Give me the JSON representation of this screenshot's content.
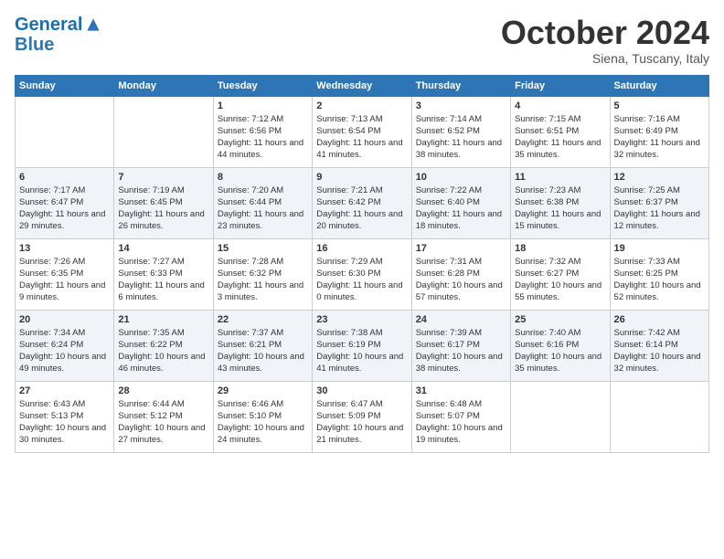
{
  "logo": {
    "line1": "General",
    "line2": "Blue"
  },
  "title": "October 2024",
  "subtitle": "Siena, Tuscany, Italy",
  "days_of_week": [
    "Sunday",
    "Monday",
    "Tuesday",
    "Wednesday",
    "Thursday",
    "Friday",
    "Saturday"
  ],
  "weeks": [
    [
      {
        "day": "",
        "sunrise": "",
        "sunset": "",
        "daylight": ""
      },
      {
        "day": "",
        "sunrise": "",
        "sunset": "",
        "daylight": ""
      },
      {
        "day": "1",
        "sunrise": "Sunrise: 7:12 AM",
        "sunset": "Sunset: 6:56 PM",
        "daylight": "Daylight: 11 hours and 44 minutes."
      },
      {
        "day": "2",
        "sunrise": "Sunrise: 7:13 AM",
        "sunset": "Sunset: 6:54 PM",
        "daylight": "Daylight: 11 hours and 41 minutes."
      },
      {
        "day": "3",
        "sunrise": "Sunrise: 7:14 AM",
        "sunset": "Sunset: 6:52 PM",
        "daylight": "Daylight: 11 hours and 38 minutes."
      },
      {
        "day": "4",
        "sunrise": "Sunrise: 7:15 AM",
        "sunset": "Sunset: 6:51 PM",
        "daylight": "Daylight: 11 hours and 35 minutes."
      },
      {
        "day": "5",
        "sunrise": "Sunrise: 7:16 AM",
        "sunset": "Sunset: 6:49 PM",
        "daylight": "Daylight: 11 hours and 32 minutes."
      }
    ],
    [
      {
        "day": "6",
        "sunrise": "Sunrise: 7:17 AM",
        "sunset": "Sunset: 6:47 PM",
        "daylight": "Daylight: 11 hours and 29 minutes."
      },
      {
        "day": "7",
        "sunrise": "Sunrise: 7:19 AM",
        "sunset": "Sunset: 6:45 PM",
        "daylight": "Daylight: 11 hours and 26 minutes."
      },
      {
        "day": "8",
        "sunrise": "Sunrise: 7:20 AM",
        "sunset": "Sunset: 6:44 PM",
        "daylight": "Daylight: 11 hours and 23 minutes."
      },
      {
        "day": "9",
        "sunrise": "Sunrise: 7:21 AM",
        "sunset": "Sunset: 6:42 PM",
        "daylight": "Daylight: 11 hours and 20 minutes."
      },
      {
        "day": "10",
        "sunrise": "Sunrise: 7:22 AM",
        "sunset": "Sunset: 6:40 PM",
        "daylight": "Daylight: 11 hours and 18 minutes."
      },
      {
        "day": "11",
        "sunrise": "Sunrise: 7:23 AM",
        "sunset": "Sunset: 6:38 PM",
        "daylight": "Daylight: 11 hours and 15 minutes."
      },
      {
        "day": "12",
        "sunrise": "Sunrise: 7:25 AM",
        "sunset": "Sunset: 6:37 PM",
        "daylight": "Daylight: 11 hours and 12 minutes."
      }
    ],
    [
      {
        "day": "13",
        "sunrise": "Sunrise: 7:26 AM",
        "sunset": "Sunset: 6:35 PM",
        "daylight": "Daylight: 11 hours and 9 minutes."
      },
      {
        "day": "14",
        "sunrise": "Sunrise: 7:27 AM",
        "sunset": "Sunset: 6:33 PM",
        "daylight": "Daylight: 11 hours and 6 minutes."
      },
      {
        "day": "15",
        "sunrise": "Sunrise: 7:28 AM",
        "sunset": "Sunset: 6:32 PM",
        "daylight": "Daylight: 11 hours and 3 minutes."
      },
      {
        "day": "16",
        "sunrise": "Sunrise: 7:29 AM",
        "sunset": "Sunset: 6:30 PM",
        "daylight": "Daylight: 11 hours and 0 minutes."
      },
      {
        "day": "17",
        "sunrise": "Sunrise: 7:31 AM",
        "sunset": "Sunset: 6:28 PM",
        "daylight": "Daylight: 10 hours and 57 minutes."
      },
      {
        "day": "18",
        "sunrise": "Sunrise: 7:32 AM",
        "sunset": "Sunset: 6:27 PM",
        "daylight": "Daylight: 10 hours and 55 minutes."
      },
      {
        "day": "19",
        "sunrise": "Sunrise: 7:33 AM",
        "sunset": "Sunset: 6:25 PM",
        "daylight": "Daylight: 10 hours and 52 minutes."
      }
    ],
    [
      {
        "day": "20",
        "sunrise": "Sunrise: 7:34 AM",
        "sunset": "Sunset: 6:24 PM",
        "daylight": "Daylight: 10 hours and 49 minutes."
      },
      {
        "day": "21",
        "sunrise": "Sunrise: 7:35 AM",
        "sunset": "Sunset: 6:22 PM",
        "daylight": "Daylight: 10 hours and 46 minutes."
      },
      {
        "day": "22",
        "sunrise": "Sunrise: 7:37 AM",
        "sunset": "Sunset: 6:21 PM",
        "daylight": "Daylight: 10 hours and 43 minutes."
      },
      {
        "day": "23",
        "sunrise": "Sunrise: 7:38 AM",
        "sunset": "Sunset: 6:19 PM",
        "daylight": "Daylight: 10 hours and 41 minutes."
      },
      {
        "day": "24",
        "sunrise": "Sunrise: 7:39 AM",
        "sunset": "Sunset: 6:17 PM",
        "daylight": "Daylight: 10 hours and 38 minutes."
      },
      {
        "day": "25",
        "sunrise": "Sunrise: 7:40 AM",
        "sunset": "Sunset: 6:16 PM",
        "daylight": "Daylight: 10 hours and 35 minutes."
      },
      {
        "day": "26",
        "sunrise": "Sunrise: 7:42 AM",
        "sunset": "Sunset: 6:14 PM",
        "daylight": "Daylight: 10 hours and 32 minutes."
      }
    ],
    [
      {
        "day": "27",
        "sunrise": "Sunrise: 6:43 AM",
        "sunset": "Sunset: 5:13 PM",
        "daylight": "Daylight: 10 hours and 30 minutes."
      },
      {
        "day": "28",
        "sunrise": "Sunrise: 6:44 AM",
        "sunset": "Sunset: 5:12 PM",
        "daylight": "Daylight: 10 hours and 27 minutes."
      },
      {
        "day": "29",
        "sunrise": "Sunrise: 6:46 AM",
        "sunset": "Sunset: 5:10 PM",
        "daylight": "Daylight: 10 hours and 24 minutes."
      },
      {
        "day": "30",
        "sunrise": "Sunrise: 6:47 AM",
        "sunset": "Sunset: 5:09 PM",
        "daylight": "Daylight: 10 hours and 21 minutes."
      },
      {
        "day": "31",
        "sunrise": "Sunrise: 6:48 AM",
        "sunset": "Sunset: 5:07 PM",
        "daylight": "Daylight: 10 hours and 19 minutes."
      },
      {
        "day": "",
        "sunrise": "",
        "sunset": "",
        "daylight": ""
      },
      {
        "day": "",
        "sunrise": "",
        "sunset": "",
        "daylight": ""
      }
    ]
  ]
}
